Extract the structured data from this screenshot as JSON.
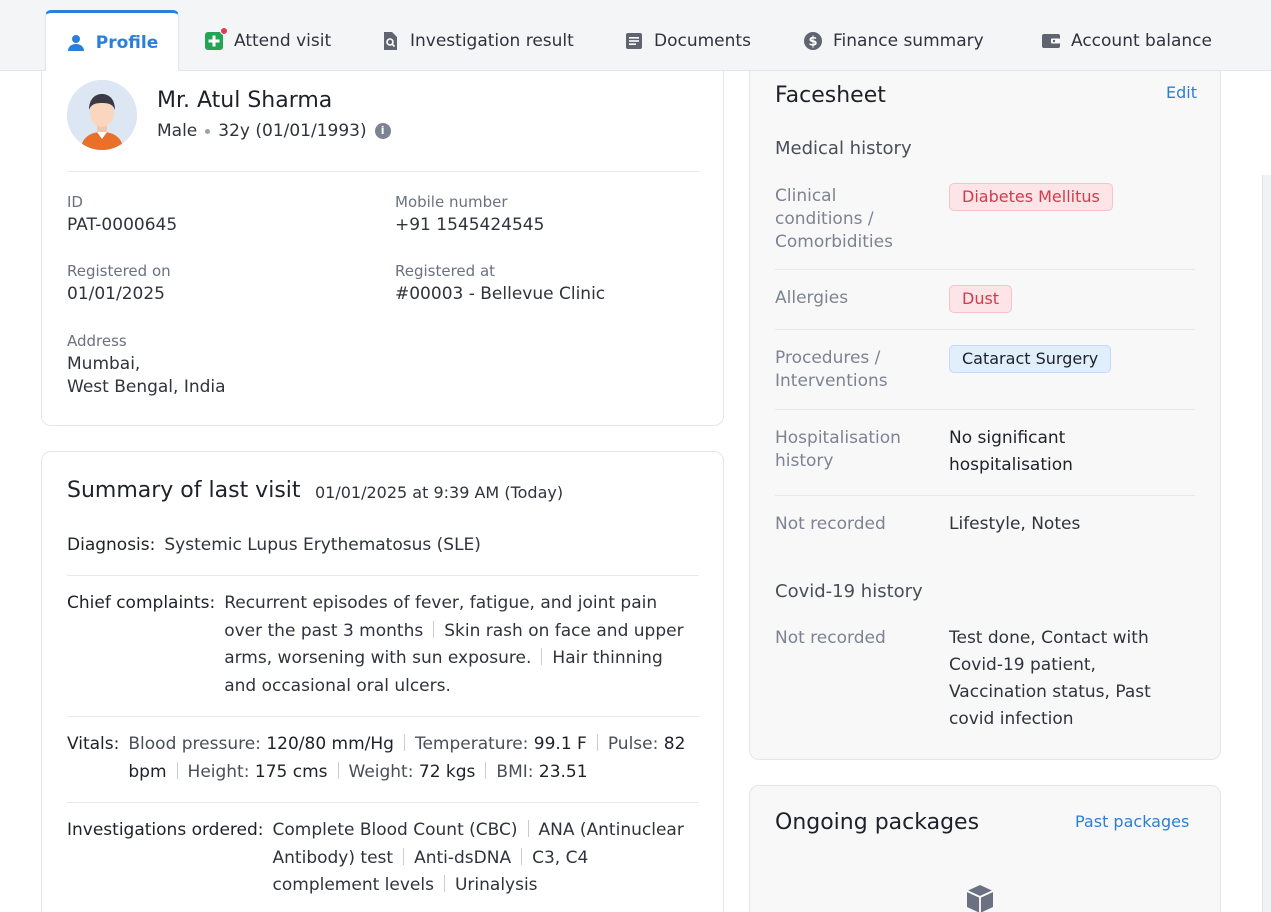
{
  "tabs": [
    {
      "label": "Profile",
      "icon": "user-icon",
      "active": true
    },
    {
      "label": "Attend visit",
      "icon": "medical-plus-icon"
    },
    {
      "label": "Investigation result",
      "icon": "file-search-icon"
    },
    {
      "label": "Documents",
      "icon": "document-icon"
    },
    {
      "label": "Finance summary",
      "icon": "dollar-coin-icon"
    },
    {
      "label": "Account balance",
      "icon": "wallet-icon"
    }
  ],
  "patient": {
    "name": "Mr. Atul Sharma",
    "gender": "Male",
    "age": "32y (01/01/1993)",
    "id_label": "ID",
    "id": "PAT-0000645",
    "mobile_label": "Mobile number",
    "mobile": "+91 1545424545",
    "registered_on_label": "Registered on",
    "registered_on": "01/01/2025",
    "registered_at_label": "Registered at",
    "registered_at": "#00003 - Bellevue Clinic",
    "address_label": "Address",
    "address_line1": "Mumbai,",
    "address_line2": "West Bengal, India"
  },
  "summary": {
    "title": "Summary of last visit",
    "date": "01/01/2025 at 9:39 AM (Today)",
    "diagnosis_label": "Diagnosis:",
    "diagnosis": "Systemic Lupus Erythematosus (SLE)",
    "complaints_label": "Chief complaints:",
    "complaints": [
      "Recurrent episodes of fever, fatigue, and joint pain over the past 3 months",
      "Skin rash on face and upper arms, worsening with sun exposure.",
      "Hair thinning and occasional oral ulcers."
    ],
    "vitals_label": "Vitals:",
    "vitals": [
      {
        "name": "Blood pressure:",
        "value": "120/80 mm/Hg"
      },
      {
        "name": "Temperature:",
        "value": "99.1 F"
      },
      {
        "name": "Pulse:",
        "value": "82 bpm"
      },
      {
        "name": "Height:",
        "value": "175 cms"
      },
      {
        "name": "Weight:",
        "value": "72 kgs"
      },
      {
        "name": "BMI:",
        "value": "23.51"
      }
    ],
    "investigations_label": "Investigations ordered:",
    "investigations": [
      "Complete Blood Count (CBC)",
      "ANA (Antinuclear Antibody) test",
      "Anti-dsDNA",
      "C3, C4 complement levels",
      "Urinalysis"
    ]
  },
  "facesheet": {
    "title": "Facesheet",
    "edit_label": "Edit",
    "medical_history_heading": "Medical history",
    "clinical_label": "Clinical conditions / Comorbidities",
    "clinical_chip": "Diabetes Mellitus",
    "allergies_label": "Allergies",
    "allergies_chip": "Dust",
    "procedures_label": "Procedures / Interventions",
    "procedures_chip": "Cataract Surgery",
    "hospitalisation_label": "Hospitalisation history",
    "hospitalisation_value": "No significant hospitalisation",
    "not_recorded_label": "Not recorded",
    "not_recorded_value": "Lifestyle, Notes",
    "covid_heading": "Covid-19 history",
    "covid_not_recorded_label": "Not recorded",
    "covid_not_recorded_value": "Test done, Contact with Covid-19 patient, Vaccination status, Past covid infection"
  },
  "packages": {
    "title": "Ongoing packages",
    "past_link": "Past packages",
    "empty_icon": "package-box-icon"
  },
  "colors": {
    "accent": "#2b7fd8",
    "danger_chip": "#fde4e6",
    "info_chip": "#e1eefb"
  }
}
